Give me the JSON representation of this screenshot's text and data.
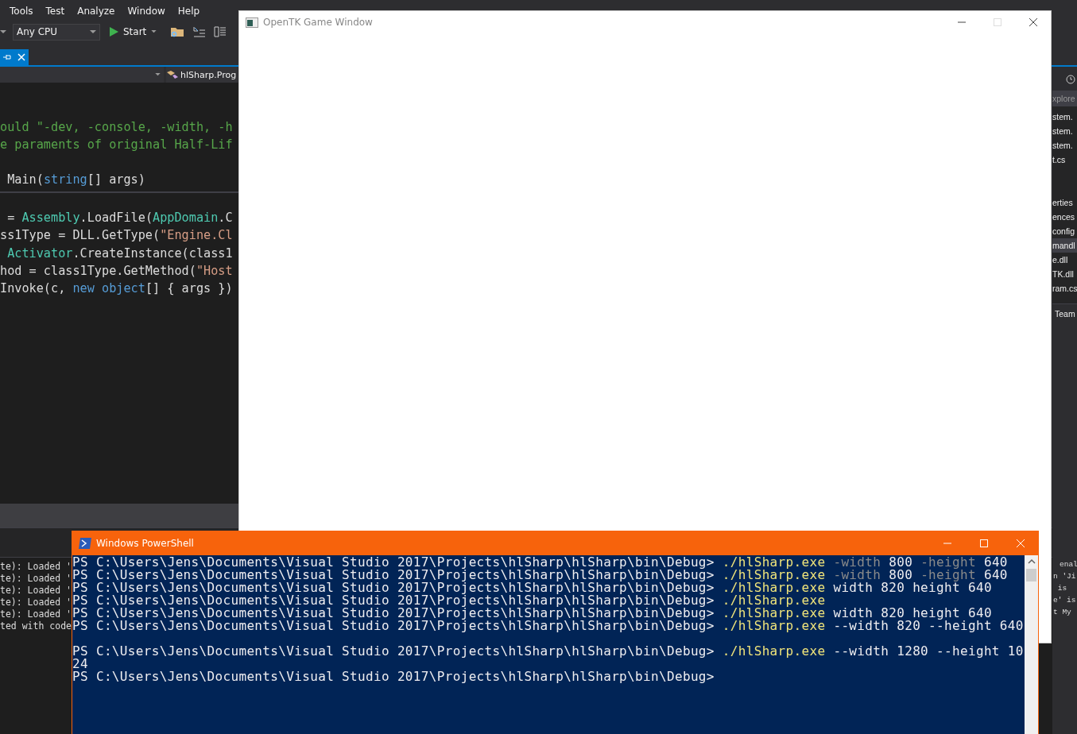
{
  "ide": {
    "menu": [
      "Tools",
      "Test",
      "Analyze",
      "Window",
      "Help"
    ],
    "toolbar": {
      "platform": "Any CPU",
      "start": "Start"
    },
    "nav": {
      "member": "hlSharp.Prog"
    },
    "code_lines": [
      {
        "kind": "blank"
      },
      {
        "kind": "blank"
      },
      {
        "kind": "code",
        "tokens": [
          {
            "kind": "comment",
            "text": "ould \"-dev, -console, -width, -h"
          }
        ]
      },
      {
        "kind": "code",
        "tokens": [
          {
            "kind": "comment",
            "text": "e paraments of original Half-Lif"
          }
        ]
      },
      {
        "kind": "blank"
      },
      {
        "kind": "code",
        "tokens": [
          {
            "kind": "plain",
            "text": " Main("
          },
          {
            "kind": "keyword",
            "text": "string"
          },
          {
            "kind": "plain",
            "text": "[] args)"
          }
        ]
      },
      {
        "kind": "rule"
      },
      {
        "kind": "code",
        "tokens": [
          {
            "kind": "plain",
            "text": " = "
          },
          {
            "kind": "type",
            "text": "Assembly"
          },
          {
            "kind": "plain",
            "text": ".LoadFile("
          },
          {
            "kind": "type",
            "text": "AppDomain"
          },
          {
            "kind": "plain",
            "text": ".C"
          }
        ]
      },
      {
        "kind": "code",
        "tokens": [
          {
            "kind": "plain",
            "text": "ss1Type = DLL.GetType("
          },
          {
            "kind": "string",
            "text": "\"Engine.Cl"
          }
        ]
      },
      {
        "kind": "code",
        "tokens": [
          {
            "kind": "type",
            "text": " Activator"
          },
          {
            "kind": "plain",
            "text": ".CreateInstance(class1"
          }
        ]
      },
      {
        "kind": "code",
        "tokens": [
          {
            "kind": "plain",
            "text": "hod = class1Type.GetMethod("
          },
          {
            "kind": "string",
            "text": "\"Host"
          }
        ]
      },
      {
        "kind": "code",
        "tokens": [
          {
            "kind": "plain",
            "text": "Invoke(c, "
          },
          {
            "kind": "keyword",
            "text": "new"
          },
          {
            "kind": "keyword",
            "text": " object"
          },
          {
            "kind": "plain",
            "text": "[] { args })"
          }
        ]
      }
    ],
    "output_lines": [
      "te): Loaded '",
      "te): Loaded '",
      "te): Loaded '",
      "te): Loaded '",
      "te): Loaded '",
      "ted with code"
    ],
    "solution_items": [
      {
        "kind": "header",
        "text": "xplore"
      },
      {
        "kind": "item",
        "text": "stem.",
        "selected": false
      },
      {
        "kind": "item",
        "text": "stem.",
        "selected": false
      },
      {
        "kind": "item",
        "text": "stem.",
        "selected": false
      },
      {
        "kind": "item",
        "text": "t.cs",
        "selected": false
      },
      {
        "kind": "blank"
      },
      {
        "kind": "blank"
      },
      {
        "kind": "item",
        "text": "erties",
        "selected": false
      },
      {
        "kind": "item",
        "text": "ences",
        "selected": false
      },
      {
        "kind": "item",
        "text": "config",
        "selected": false
      },
      {
        "kind": "item",
        "text": "mandl",
        "selected": true
      },
      {
        "kind": "item",
        "text": "e.dll",
        "selected": false
      },
      {
        "kind": "item",
        "text": "TK.dll",
        "selected": false
      },
      {
        "kind": "item",
        "text": "ram.cs",
        "selected": false
      },
      {
        "kind": "tab",
        "text": "Team"
      }
    ],
    "output_right": [
      "enal",
      "n 'Ji",
      " is",
      "e' is",
      "t My"
    ]
  },
  "game_window": {
    "title": "OpenTK Game Window"
  },
  "powershell": {
    "title": "Windows PowerShell",
    "lines": [
      {
        "kind": "line",
        "parts": [
          {
            "kind": "prompt",
            "text": "PS C:\\Users\\Jens\\Documents\\Visual Studio 2017\\Projects\\hlSharp\\hlSharp\\bin\\Debug> "
          },
          {
            "kind": "command",
            "text": "./hlSharp.exe"
          },
          {
            "kind": "param",
            "text": " -width"
          },
          {
            "kind": "arg",
            "text": " 800"
          },
          {
            "kind": "param",
            "text": " -height"
          },
          {
            "kind": "arg",
            "text": " 640"
          }
        ]
      },
      {
        "kind": "line",
        "parts": [
          {
            "kind": "prompt",
            "text": "PS C:\\Users\\Jens\\Documents\\Visual Studio 2017\\Projects\\hlSharp\\hlSharp\\bin\\Debug> "
          },
          {
            "kind": "command",
            "text": "./hlSharp.exe"
          },
          {
            "kind": "param",
            "text": " -width"
          },
          {
            "kind": "arg",
            "text": " 800"
          },
          {
            "kind": "param",
            "text": " -height"
          },
          {
            "kind": "arg",
            "text": " 640"
          }
        ]
      },
      {
        "kind": "line",
        "parts": [
          {
            "kind": "prompt",
            "text": "PS C:\\Users\\Jens\\Documents\\Visual Studio 2017\\Projects\\hlSharp\\hlSharp\\bin\\Debug> "
          },
          {
            "kind": "command",
            "text": "./hlSharp.exe"
          },
          {
            "kind": "arg",
            "text": " width 820 height 640"
          }
        ]
      },
      {
        "kind": "line",
        "parts": [
          {
            "kind": "prompt",
            "text": "PS C:\\Users\\Jens\\Documents\\Visual Studio 2017\\Projects\\hlSharp\\hlSharp\\bin\\Debug> "
          },
          {
            "kind": "command",
            "text": "./hlSharp.exe"
          }
        ]
      },
      {
        "kind": "line",
        "parts": [
          {
            "kind": "prompt",
            "text": "PS C:\\Users\\Jens\\Documents\\Visual Studio 2017\\Projects\\hlSharp\\hlSharp\\bin\\Debug> "
          },
          {
            "kind": "command",
            "text": "./hlSharp.exe"
          },
          {
            "kind": "arg",
            "text": " width 820 height 640"
          }
        ]
      },
      {
        "kind": "line",
        "parts": [
          {
            "kind": "prompt",
            "text": "PS C:\\Users\\Jens\\Documents\\Visual Studio 2017\\Projects\\hlSharp\\hlSharp\\bin\\Debug> "
          },
          {
            "kind": "command",
            "text": "./hlSharp.exe"
          },
          {
            "kind": "arg",
            "text": " --width 820 --height 640"
          }
        ]
      },
      {
        "kind": "blank"
      },
      {
        "kind": "line",
        "parts": [
          {
            "kind": "prompt",
            "text": "PS C:\\Users\\Jens\\Documents\\Visual Studio 2017\\Projects\\hlSharp\\hlSharp\\bin\\Debug> "
          },
          {
            "kind": "command",
            "text": "./hlSharp.exe"
          },
          {
            "kind": "arg",
            "text": " --width 1280 --height 10"
          }
        ]
      },
      {
        "kind": "line",
        "parts": [
          {
            "kind": "arg",
            "text": "24"
          }
        ]
      },
      {
        "kind": "line",
        "parts": [
          {
            "kind": "prompt",
            "text": "PS C:\\Users\\Jens\\Documents\\Visual Studio 2017\\Projects\\hlSharp\\hlSharp\\bin\\Debug>"
          }
        ]
      }
    ]
  }
}
